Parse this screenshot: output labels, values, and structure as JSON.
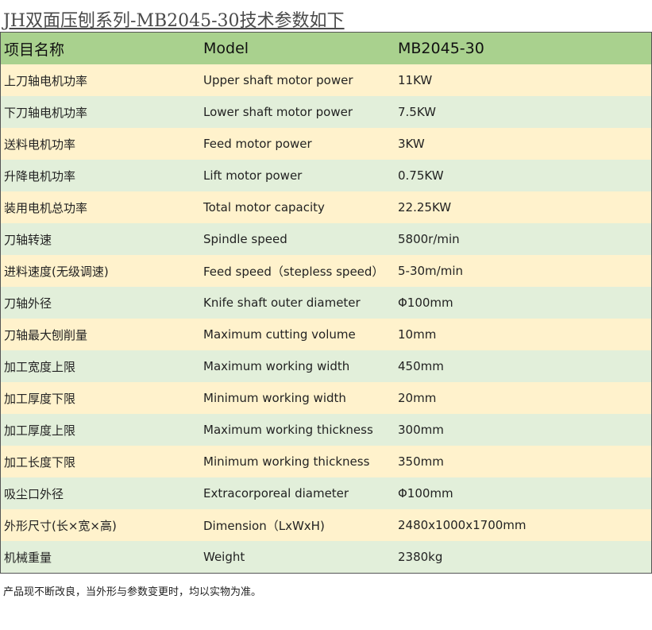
{
  "title": "JH双面压刨系列-MB2045-30技术参数如下",
  "colors": {
    "header_bg": "#a9d18e",
    "row_odd_bg": "#fff2cc",
    "row_even_bg": "#e2efda",
    "border": "#555555"
  },
  "table": {
    "headers": [
      "项目名称",
      "Model",
      "MB2045-30"
    ],
    "rows": [
      [
        "上刀轴电机功率",
        "Upper shaft motor power",
        "11KW"
      ],
      [
        "下刀轴电机功率",
        "Lower shaft motor power",
        "7.5KW"
      ],
      [
        "送料电机功率",
        "Feed motor power",
        "3KW"
      ],
      [
        "升降电机功率",
        "Lift motor power",
        "0.75KW"
      ],
      [
        "装用电机总功率",
        "Total motor capacity",
        "22.25KW"
      ],
      [
        "刀轴转速",
        "Spindle speed",
        "5800r/min"
      ],
      [
        "进料速度(无级调速)",
        "Feed speed（stepless speed）",
        "5-30m/min"
      ],
      [
        "刀轴外径",
        "Knife shaft outer diameter",
        "Φ100mm"
      ],
      [
        "刀轴最大刨削量",
        "Maximum cutting volume",
        "10mm"
      ],
      [
        "加工宽度上限",
        "Maximum working width",
        "450mm"
      ],
      [
        "加工厚度下限",
        "Minimum working width",
        "20mm"
      ],
      [
        "加工厚度上限",
        "Maximum working thickness",
        "300mm"
      ],
      [
        "加工长度下限",
        "Minimum working thickness",
        "350mm"
      ],
      [
        "吸尘口外径",
        "Extracorporeal diameter",
        "Φ100mm"
      ],
      [
        "外形尺寸(长×宽×高)",
        "Dimension（LxWxH)",
        "2480x1000x1700mm"
      ],
      [
        "机械重量",
        "Weight",
        "2380kg"
      ]
    ]
  },
  "note": "产品现不断改良，当外形与参数变更时，均以实物为准。"
}
